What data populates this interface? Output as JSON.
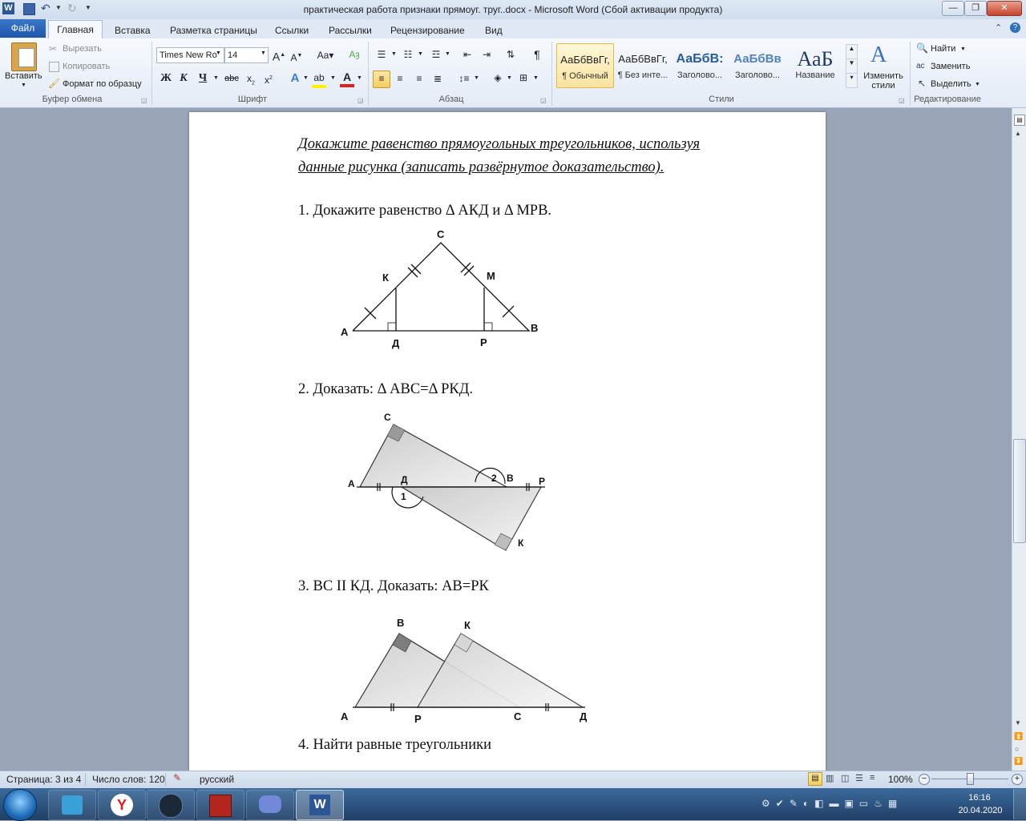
{
  "window": {
    "title": "практическая работа признаки прямоуг. труг..docx  -  Microsoft Word (Сбой активации продукта)"
  },
  "tabs": {
    "file": "Файл",
    "items": [
      "Главная",
      "Вставка",
      "Разметка страницы",
      "Ссылки",
      "Рассылки",
      "Рецензирование",
      "Вид"
    ]
  },
  "ribbon": {
    "clipboard": {
      "paste": "Вставить",
      "cut": "Вырезать",
      "copy": "Копировать",
      "format_painter": "Формат по образцу",
      "label": "Буфер обмена"
    },
    "font": {
      "name": "Times New Ro",
      "size": "14",
      "bold": "Ж",
      "italic": "К",
      "underline": "Ч",
      "strike": "abc",
      "label": "Шрифт"
    },
    "paragraph": {
      "label": "Абзац"
    },
    "styles": {
      "items": [
        {
          "preview": "АаБбВвГг,",
          "name": "¶ Обычный"
        },
        {
          "preview": "АаБбВвГг,",
          "name": "¶ Без инте..."
        },
        {
          "preview": "АаБбВ:",
          "name": "Заголово..."
        },
        {
          "preview": "АаБбВв",
          "name": "Заголово..."
        },
        {
          "preview": "АаБ",
          "name": "Название"
        }
      ],
      "change": "Изменить стили",
      "label": "Стили"
    },
    "editing": {
      "find": "Найти",
      "replace": "Заменить",
      "select": "Выделить",
      "label": "Редактирование"
    }
  },
  "document": {
    "heading_line1": "Докажите равенство прямоугольных треугольников, используя",
    "heading_line2": "данные рисунка (записать развёрнутое доказательство).",
    "task1": "1.  Докажите равенство Δ АКД и Δ МРВ.",
    "task2": "2.  Доказать: Δ АВС=Δ РКД.",
    "task3": "3.  ВС ІІ КД. Доказать: АВ=РК",
    "task4": "4.  Найти равные треугольники",
    "fig1": {
      "C": "С",
      "K": "К",
      "M": "М",
      "A": "А",
      "B": "В",
      "D": "Д",
      "P": "Р"
    },
    "fig2": {
      "C": "С",
      "A": "А",
      "D": "Д",
      "B": "В",
      "P": "Р",
      "K": "К",
      "one": "1",
      "two": "2"
    },
    "fig3": {
      "B": "В",
      "K": "К",
      "A": "А",
      "P": "Р",
      "C": "С",
      "D": "Д"
    }
  },
  "status": {
    "page": "Страница: 3 из 4",
    "words": "Число слов: 120",
    "lang": "русский",
    "zoom": "100%"
  },
  "taskbar": {
    "time": "16:16",
    "date": "20.04.2020"
  }
}
